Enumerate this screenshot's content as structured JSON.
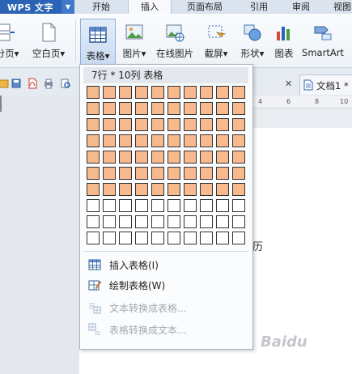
{
  "app": {
    "title": "WPS 文字"
  },
  "tabs": [
    {
      "label": "开始",
      "active": false
    },
    {
      "label": "插入",
      "active": true
    },
    {
      "label": "页面布局",
      "active": false
    },
    {
      "label": "引用",
      "active": false
    },
    {
      "label": "审阅",
      "active": false
    },
    {
      "label": "视图",
      "active": false
    }
  ],
  "ribbon": {
    "page_break": "分页",
    "blank_page": "空白页",
    "table": "表格",
    "picture": "图片",
    "online_picture": "在线图片",
    "screenshot": "截屏",
    "shapes": "形状",
    "chart": "图表",
    "smartart": "SmartArt",
    "dropdown_arrow": "▾"
  },
  "document": {
    "tab_label": "文档1 *",
    "close_glyph": "✕",
    "ruler_marks": [
      "4",
      "6",
      "8",
      "10"
    ],
    "text_fragment": "历"
  },
  "table_dropdown": {
    "header": "7行 * 10列 表格",
    "grid": {
      "rows": 10,
      "cols": 10,
      "selected_rows": 7,
      "selected_cols": 10
    },
    "items": [
      {
        "label": "插入表格(I)",
        "icon": "insert-table-icon",
        "enabled": true
      },
      {
        "label": "绘制表格(W)",
        "icon": "draw-table-icon",
        "enabled": true
      },
      {
        "label": "文本转换成表格...",
        "icon": "text-to-table-icon",
        "enabled": false
      },
      {
        "label": "表格转换成文本...",
        "icon": "table-to-text-icon",
        "enabled": false
      }
    ]
  },
  "colors": {
    "accent": "#2b63b6",
    "grid_selected": "#f8ba8d",
    "grid_border": "#333333"
  }
}
